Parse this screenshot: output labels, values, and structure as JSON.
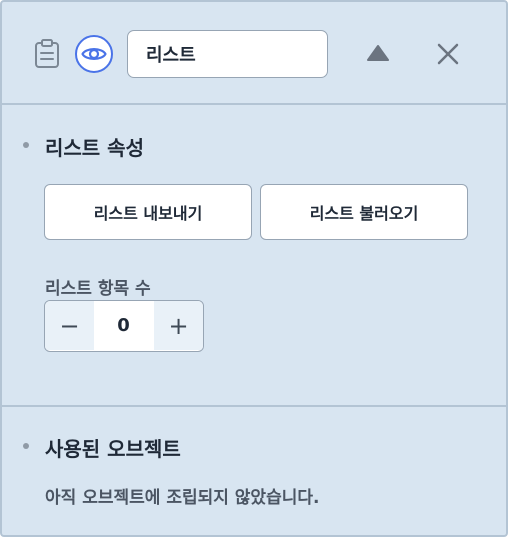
{
  "header": {
    "list_name_value": "리스트",
    "icons": {
      "clipboard": "clipboard-icon",
      "visibility": "eye-icon",
      "collapse": "triangle-up-icon",
      "close": "close-icon"
    },
    "accent_color": "#4a73e8"
  },
  "list_properties": {
    "title": "리스트 속성",
    "export_label": "리스트 내보내기",
    "import_label": "리스트 불러오기",
    "item_count_label": "리스트 항목 수",
    "item_count_value": "0",
    "minus_symbol": "−",
    "plus_symbol": "+"
  },
  "used_objects": {
    "title": "사용된 오브젝트",
    "empty_message": "아직 오브젝트에 조립되지 않았습니다."
  }
}
